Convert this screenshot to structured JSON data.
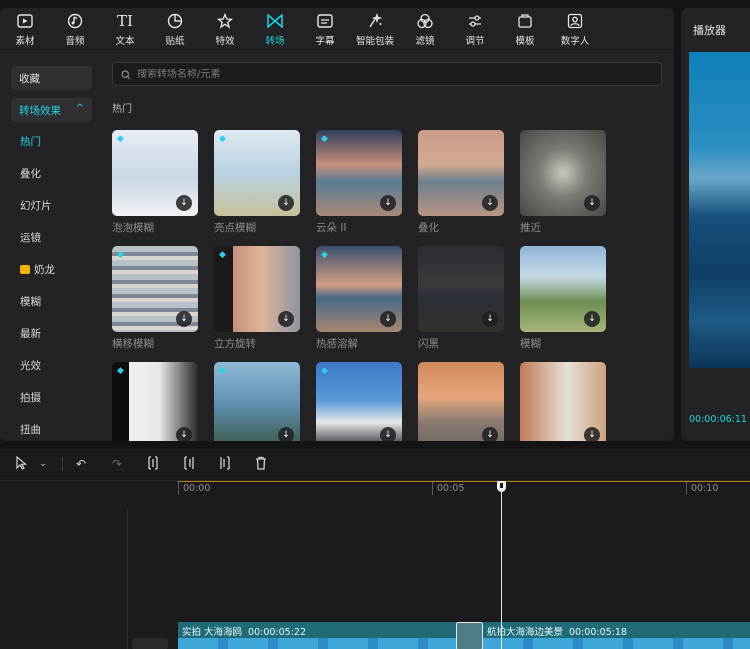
{
  "toolbar": {
    "items": [
      {
        "label": "素材",
        "icon": "media-icon"
      },
      {
        "label": "音频",
        "icon": "audio-icon"
      },
      {
        "label": "文本",
        "icon": "text-icon"
      },
      {
        "label": "贴纸",
        "icon": "sticker-icon"
      },
      {
        "label": "特效",
        "icon": "effects-icon"
      },
      {
        "label": "转场",
        "icon": "transition-icon",
        "active": true
      },
      {
        "label": "字幕",
        "icon": "subtitle-icon"
      },
      {
        "label": "智能包装",
        "icon": "smart-pack-icon"
      },
      {
        "label": "滤镜",
        "icon": "filter-icon"
      },
      {
        "label": "调节",
        "icon": "adjust-icon"
      },
      {
        "label": "模板",
        "icon": "template-icon"
      },
      {
        "label": "数字人",
        "icon": "digital-human-icon"
      }
    ]
  },
  "sidebar": {
    "favorites": "收藏",
    "category": "转场效果",
    "items": [
      {
        "label": "热门",
        "selected": true
      },
      {
        "label": "叠化"
      },
      {
        "label": "幻灯片"
      },
      {
        "label": "运镜"
      },
      {
        "label": "奶龙",
        "badge": "coin"
      },
      {
        "label": "模糊"
      },
      {
        "label": "最新"
      },
      {
        "label": "光效"
      },
      {
        "label": "拍摄"
      },
      {
        "label": "扭曲"
      }
    ]
  },
  "search": {
    "placeholder": "搜索转场名称/元素"
  },
  "section": {
    "title": "热门"
  },
  "cards": [
    {
      "name": "泡泡模糊",
      "premium": true,
      "bg": "linear-gradient(180deg,#e8eef5 0%,#c9d6e4 55%,#f2f3f5 100%)"
    },
    {
      "name": "亮点模糊",
      "premium": true,
      "bg": "linear-gradient(180deg,#dfe9f1 0%,#b9d1e2 50%,#c7c09a 100%)"
    },
    {
      "name": "云朵 II",
      "premium": true,
      "bg": "linear-gradient(180deg,#2f3f5c 0%,#c88e7a 40%,#5a7d94 60%,#a8887a 100%)"
    },
    {
      "name": "叠化",
      "premium": false,
      "bg": "linear-gradient(180deg,#c89a8a 0%,#d3aa92 40%,#6d7f8d 60%,#b99484 100%)"
    },
    {
      "name": "推近",
      "premium": false,
      "bg": "radial-gradient(circle,#c9c6bf 0%,#7d7a75 40%,#4a4844 100%)"
    },
    {
      "name": "横移模糊",
      "premium": true,
      "bg": "repeating-linear-gradient(180deg,#b8c0c8 0 6px,#7b8794 6px 10px,#d9d4cc 10px 14px)"
    },
    {
      "name": "立方旋转",
      "premium": true,
      "bg": "linear-gradient(90deg,#1a1a1a 0%,#1a1a1a 22%,#c48f7a 22%,#e0b49a 55%,#8c95a3 100%)"
    },
    {
      "name": "热感溶解",
      "premium": true,
      "bg": "linear-gradient(180deg,#3a4f6e 0%,#d39c82 45%,#466a86 60%,#a88572 100%)"
    },
    {
      "name": "闪黑",
      "premium": false,
      "bg": "linear-gradient(180deg,#2b2b32 0%,#3c3a3e 45%,#2a2f38 60%,#34302e 100%)"
    },
    {
      "name": "模糊",
      "premium": false,
      "bg": "linear-gradient(180deg,#8eb4d8 0%,#c6d9e6 35%,#6f8f55 65%,#a9b77a 100%)"
    },
    {
      "name": "",
      "premium": true,
      "bg": "linear-gradient(90deg,#0e0e10 0%,#0e0e10 20%,#f0f0f0 20%,#e8e8e8 55%,#2a2a2e 100%)"
    },
    {
      "name": "",
      "premium": true,
      "bg": "linear-gradient(180deg,#8fb8d6 0%,#5f8fb0 50%,#3a5a46 100%)"
    },
    {
      "name": "",
      "premium": true,
      "bg": "linear-gradient(180deg,#3d78c8 0%,#5a9ad8 45%,#e8e8e8 70%,#2a2f38 100%)"
    },
    {
      "name": "",
      "premium": false,
      "bg": "linear-gradient(180deg,#d18a5c 0%,#e6a57a 40%,#8a7a72 70%,#6e6862 100%)"
    },
    {
      "name": "",
      "premium": false,
      "bg": "linear-gradient(90deg,#c07a56 0%,#e7e1d8 55%,#cba27f 100%)"
    }
  ],
  "player": {
    "title": "播放器",
    "time": "00:00:06:11"
  },
  "timeline": {
    "ruler": [
      "00:00",
      "00:05",
      "00:10"
    ],
    "clips": [
      {
        "label": "实拍 大海海鸥",
        "duration": "00:00:05:22"
      },
      {
        "label": "航拍大海海边美景",
        "duration": "00:00:05:18"
      }
    ]
  },
  "colors": {
    "accent": "#1fd4e0",
    "panel": "#232326",
    "background": "#141416"
  }
}
